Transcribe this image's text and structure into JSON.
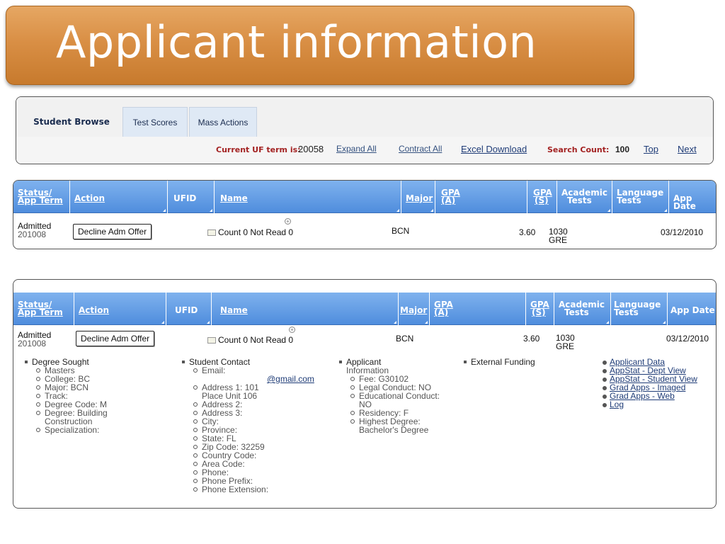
{
  "title": "Applicant information",
  "tabs": [
    {
      "label": "Student Browse",
      "active": true
    },
    {
      "label": "Test Scores",
      "active": false
    },
    {
      "label": "Mass Actions",
      "active": false
    }
  ],
  "toolbar": {
    "term_label": "Current UF term is:",
    "term_value": "20058",
    "expand_all": "Expand All",
    "contract_all": "Contract All",
    "excel_download": "Excel Download",
    "search_count_label": "Search Count:",
    "search_count_value": "100",
    "top": "Top",
    "next": "Next"
  },
  "columns": {
    "status_l1": "Status/",
    "status_l2": "App Term",
    "action": "Action",
    "ufid": "UFID",
    "name": "Name",
    "major": "Major",
    "gpa_a_l1": "GPA",
    "gpa_a_l2": "(A)",
    "gpa_s_l1": "GPA",
    "gpa_s_l2": "(S)",
    "academic_l1": "Academic",
    "academic_l2": "Tests",
    "language_l1": "Language",
    "language_l2": "Tests",
    "app_date": "App Date"
  },
  "row": {
    "status": "Admitted",
    "term": "201008",
    "action_button": "Decline Adm Offer",
    "message": "Count 0 Not Read 0",
    "major": "BCN",
    "gpa_s": "3.60",
    "academic_score": "1030",
    "academic_test": "GRE",
    "app_date": "03/12/2010"
  },
  "details": {
    "degree_sought": {
      "heading": "Degree Sought",
      "items": [
        "Masters",
        "College: BC",
        "Major: BCN",
        "Track:",
        "Degree Code: M",
        "Degree: Building",
        "Specialization:"
      ],
      "degree_cont": "Construction"
    },
    "student_contact": {
      "heading": "Student Contact",
      "email_label": "Email:",
      "email_value": "@gmail.com",
      "address1": "Address 1: 101",
      "address1_cont": "Place Unit 106",
      "items": [
        "Address 2:",
        "Address 3:",
        "City:",
        "Province:",
        "State: FL",
        "Zip Code: 32259",
        "Country Code:",
        "Area Code:",
        "Phone:",
        "Phone Prefix:",
        "Phone Extension:"
      ]
    },
    "applicant_information": {
      "heading_l1": "Applicant",
      "heading_l2": "Information",
      "fee": "Fee: G30102",
      "legal": "Legal Conduct: NO",
      "educational": "Educational Conduct:",
      "educational_cont": "NO",
      "residency": "Residency: F",
      "highest": "Highest Degree:",
      "highest_cont": "Bachelor's Degree"
    },
    "external_funding": {
      "heading": "External Funding"
    },
    "links": [
      "Applicant Data",
      "AppStat - Dept View",
      "AppStat - Student View",
      "Grad Apps - Imaged",
      "Grad Apps - Web",
      "Log"
    ]
  },
  "colors": {
    "banner": "#d98f45",
    "header_blue": "#5a96e2",
    "red_label": "#a32222",
    "link_blue": "#1f3c77"
  },
  "icons": [
    "envelope-icon",
    "expand-plus-icon",
    "sort-corner-icon"
  ]
}
